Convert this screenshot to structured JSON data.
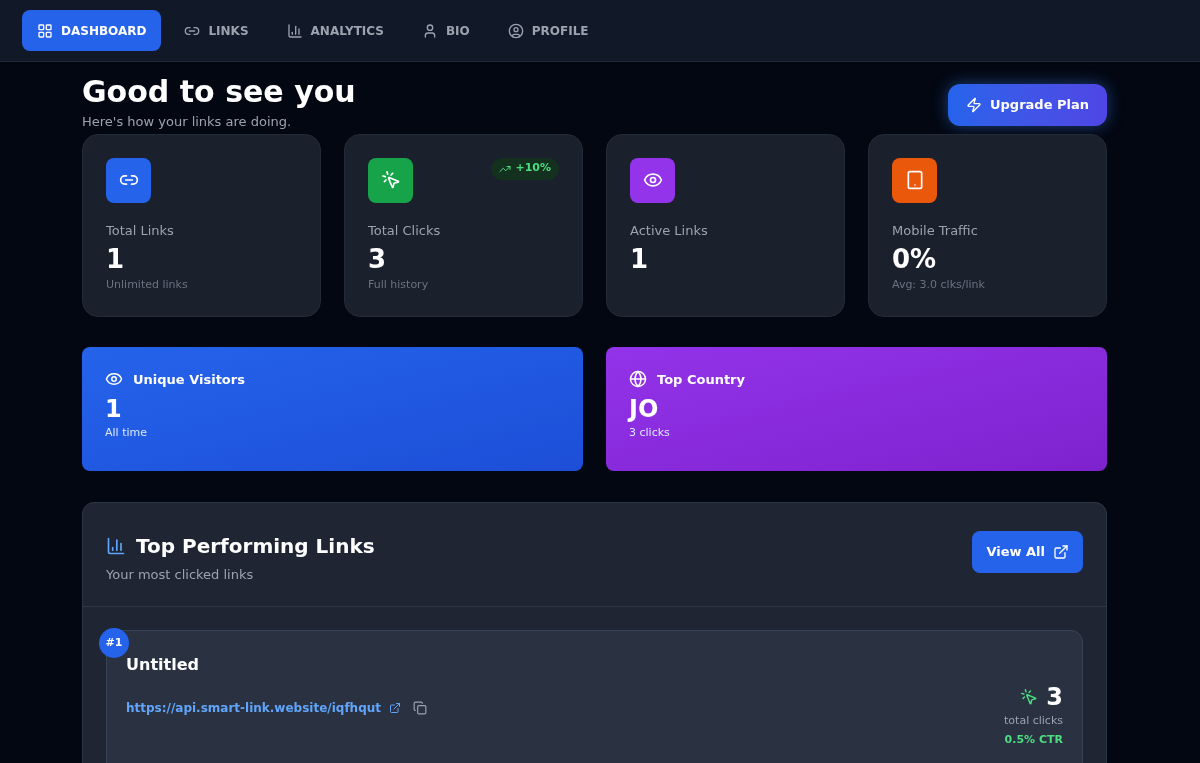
{
  "nav": [
    {
      "label": "DASHBOARD",
      "kind": "grid",
      "selected": true
    },
    {
      "label": "LINKS",
      "kind": "link",
      "selected": false
    },
    {
      "label": "ANALYTICS",
      "kind": "chart",
      "selected": false
    },
    {
      "label": "BIO",
      "kind": "user",
      "selected": false
    },
    {
      "label": "PROFILE",
      "kind": "profile",
      "selected": false
    }
  ],
  "header": {
    "title": "Good to see you",
    "subtitle": "Here's how your links are doing.",
    "button": "Upgrade Plan"
  },
  "stats": [
    {
      "label": "Total Links",
      "value": "1",
      "note": "Unlimited links",
      "kind": "link",
      "color": "#2563eb"
    },
    {
      "label": "Total Clicks",
      "value": "3",
      "note": "Full history",
      "kind": "click",
      "color": "#16a34a",
      "badge": "+10%"
    },
    {
      "label": "Active Links",
      "value": "1",
      "kind": "eye",
      "color": "#9333ea"
    },
    {
      "label": "Mobile Traffic",
      "value": "0%",
      "note": "Avg: 3.0 clks/link",
      "kind": "tablet",
      "color": "#ea580c"
    }
  ],
  "highlights": [
    {
      "label": "Unique Visitors",
      "value": "1",
      "note": "All time",
      "kind": "eye"
    },
    {
      "label": "Top Country",
      "value": "JO",
      "note": "3 clicks",
      "kind": "globe"
    }
  ],
  "top_links": {
    "title": "Top Performing Links",
    "subtitle": "Your most clicked links",
    "button": "View All",
    "items": [
      {
        "rank": "#1",
        "title": "Untitled",
        "url": "https://api.smart-link.website/iqfhqut",
        "clicks": "3",
        "clicks_label": "total clicks",
        "ctr": "0.5% CTR"
      }
    ]
  }
}
